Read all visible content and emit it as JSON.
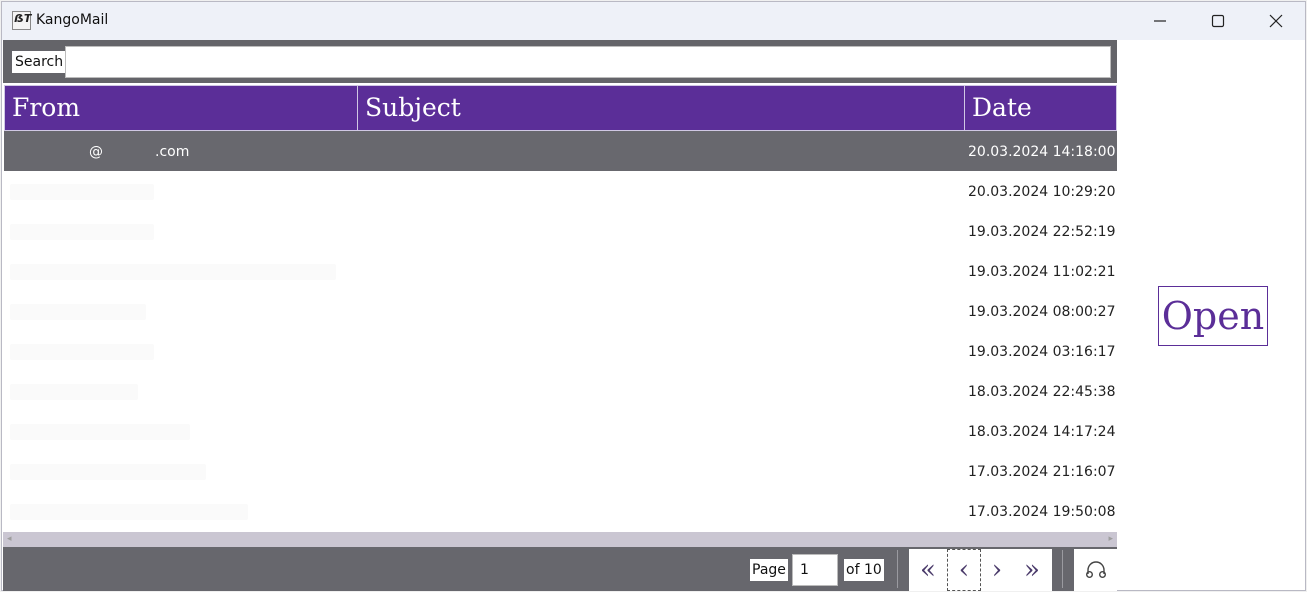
{
  "window": {
    "title": "KangoMail",
    "app_icon_glyph": "ẞT",
    "controls": [
      "minimize-icon",
      "maximize-icon",
      "close-icon"
    ]
  },
  "search": {
    "label": "Search",
    "value": ""
  },
  "table": {
    "headers": {
      "from": "From",
      "subject": "Subject",
      "date": "Date"
    },
    "rows": [
      {
        "from_at": "@",
        "from_domain": ".com",
        "subject": "",
        "date": "20.03.2024 14:18:00",
        "selected": true
      },
      {
        "from": "",
        "subject": "",
        "date": "20.03.2024 10:29:20"
      },
      {
        "from": "",
        "subject": "",
        "date": "19.03.2024 22:52:19"
      },
      {
        "from": "",
        "subject": "",
        "date": "19.03.2024 11:02:21"
      },
      {
        "from": "",
        "subject": "",
        "date": "19.03.2024 08:00:27"
      },
      {
        "from": "",
        "subject": "",
        "date": "19.03.2024 03:16:17"
      },
      {
        "from": "",
        "subject": "",
        "date": "18.03.2024 22:45:38"
      },
      {
        "from": "",
        "subject": "",
        "date": "18.03.2024 14:17:24"
      },
      {
        "from": "",
        "subject": "",
        "date": "17.03.2024 21:16:07"
      },
      {
        "from": "",
        "subject": "",
        "date": "17.03.2024 19:50:08"
      }
    ]
  },
  "pager": {
    "page_label": "Page",
    "page_value": "1",
    "of_label": "of 10",
    "first": "«",
    "prev": "‹",
    "next": "›",
    "last": "»",
    "tool_icon": "headphones-icon"
  },
  "open_button": "Open",
  "colors": {
    "accent": "#5b2e98",
    "toolbar": "#646469",
    "selected_row": "#68686e",
    "titlebar": "#eef1f8"
  }
}
